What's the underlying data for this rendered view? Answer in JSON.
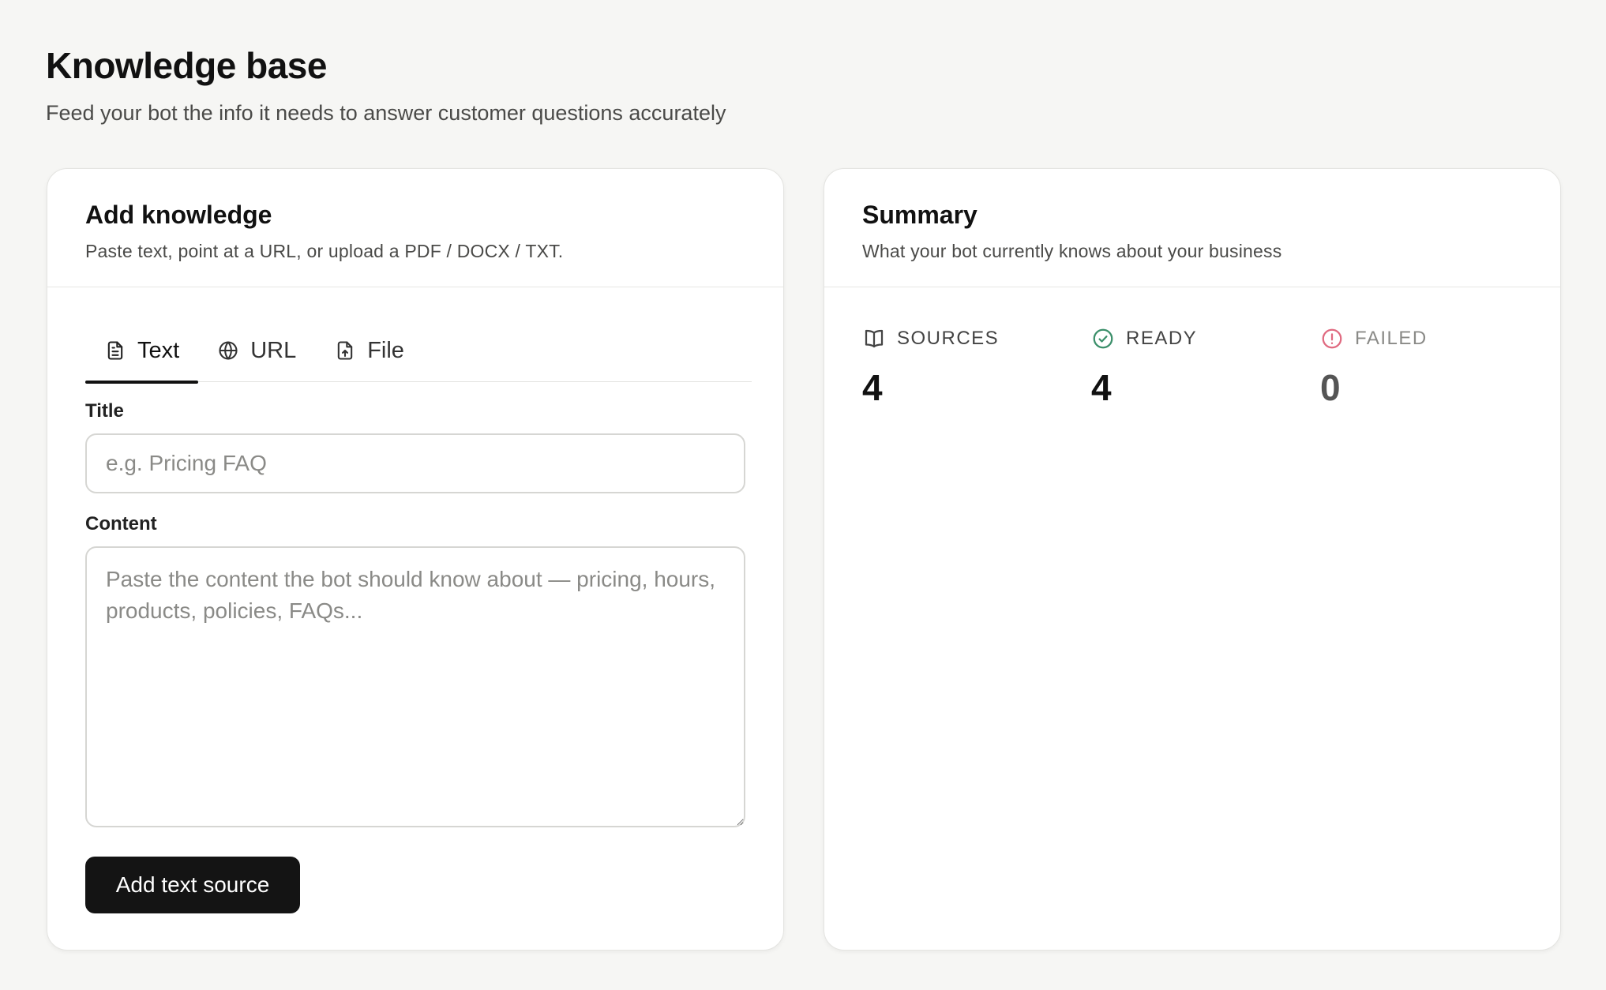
{
  "page": {
    "title": "Knowledge base",
    "subtitle": "Feed your bot the info it needs to answer customer questions accurately"
  },
  "add_knowledge": {
    "title": "Add knowledge",
    "description": "Paste text, point at a URL, or upload a PDF / DOCX / TXT.",
    "tabs": [
      {
        "label": "Text",
        "icon": "document-icon",
        "active": true
      },
      {
        "label": "URL",
        "icon": "globe-icon",
        "active": false
      },
      {
        "label": "File",
        "icon": "file-upload-icon",
        "active": false
      }
    ],
    "title_field": {
      "label": "Title",
      "value": "",
      "placeholder": "e.g. Pricing FAQ"
    },
    "content_field": {
      "label": "Content",
      "value": "",
      "placeholder": "Paste the content the bot should know about — pricing, hours, products, policies, FAQs..."
    },
    "submit_label": "Add text source"
  },
  "summary": {
    "title": "Summary",
    "description": "What your bot currently knows about your business",
    "stats": [
      {
        "label": "SOURCES",
        "value": "4",
        "icon": "book-icon"
      },
      {
        "label": "READY",
        "value": "4",
        "icon": "check-circle-icon",
        "color": "#3b8f6a"
      },
      {
        "label": "FAILED",
        "value": "0",
        "icon": "alert-circle-icon",
        "color": "#e06a80"
      }
    ]
  }
}
